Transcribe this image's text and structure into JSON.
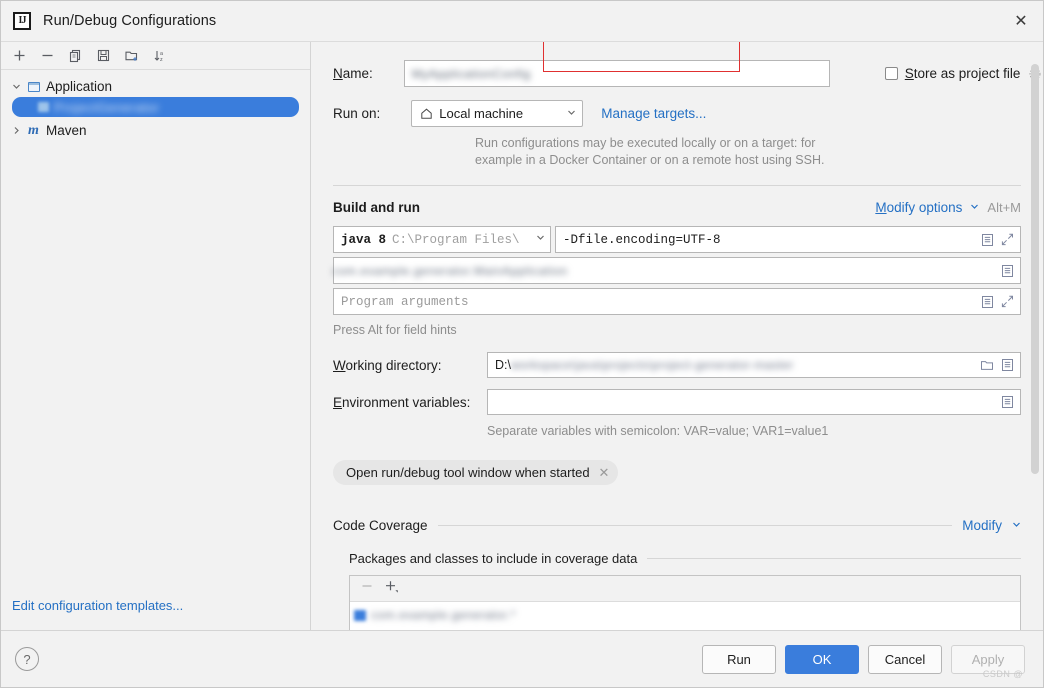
{
  "window": {
    "title": "Run/Debug Configurations",
    "logo_text": "IJ",
    "close_icon": "close-icon"
  },
  "tree_toolbar": {
    "buttons": [
      {
        "name": "add-configuration",
        "icon": "plus-icon"
      },
      {
        "name": "remove-configuration",
        "icon": "minus-icon"
      },
      {
        "name": "copy-configuration",
        "icon": "copy-icon"
      },
      {
        "name": "save-configuration",
        "icon": "save-icon"
      },
      {
        "name": "new-folder",
        "icon": "new-folder-icon"
      },
      {
        "name": "sort-configurations",
        "icon": "sort-alphabetical-icon"
      }
    ]
  },
  "tree": {
    "nodes": [
      {
        "label": "Application",
        "icon": "application-icon",
        "expanded": true,
        "arrow": "⌄"
      },
      {
        "label": "",
        "blurred": true,
        "selected": true,
        "icon": "application-icon"
      },
      {
        "label": "Maven",
        "icon": "maven-icon",
        "expanded": false,
        "arrow": "›"
      }
    ]
  },
  "left_panel": {
    "edit_templates_link": "Edit configuration templates..."
  },
  "form": {
    "name": {
      "label": "Name:",
      "label_mnemonic": "N",
      "value": "███████████████",
      "blurred": true
    },
    "store_as_project_file": {
      "label": "Store as project file",
      "label_mnemonic": "S",
      "checked": false,
      "gear_icon": "gear-icon"
    },
    "run_on": {
      "label": "Run on:",
      "selected": "Local machine",
      "icon": "home-icon",
      "chevron": "⌄",
      "manage_targets_link": "Manage targets...",
      "hint_line1": "Run configurations may be executed locally or on a target: for",
      "hint_line2": "example in a Docker Container or on a remote host using SSH."
    }
  },
  "build_and_run": {
    "title": "Build and run",
    "modify_options_link": "Modify options",
    "modify_options_mnemonic": "M",
    "modify_chevron": "⌄",
    "shortcut": "Alt+M",
    "jdk": {
      "name": "java 8",
      "path": "C:\\Program Files\\",
      "chevron": "⌄"
    },
    "vm_options": {
      "value": "-Dfile.encoding=UTF-8",
      "highlighted": true,
      "highlight_color": "#e03030",
      "icons": [
        "list-icon",
        "expand-icon"
      ]
    },
    "main_class": {
      "value": "███████████████████████",
      "blurred": true,
      "icons": [
        "list-icon"
      ]
    },
    "program_arguments": {
      "placeholder": "Program arguments",
      "value": "",
      "icons": [
        "list-icon",
        "expand-icon"
      ]
    },
    "alt_hint": "Press Alt for field hints"
  },
  "working_directory": {
    "label": "Working directory:",
    "label_mnemonic": "W",
    "value_prefix": "D:\\",
    "value_blurred": "███████████████████████████████████",
    "icons": [
      "folder-browse-icon",
      "list-icon"
    ]
  },
  "environment_variables": {
    "label": "Environment variables:",
    "label_mnemonic": "E",
    "value": "",
    "icons": [
      "list-icon"
    ],
    "hint": "Separate variables with semicolon: VAR=value; VAR1=value1"
  },
  "option_chip": {
    "label": "Open run/debug tool window when started",
    "close_icon": "close-icon"
  },
  "code_coverage": {
    "title": "Code Coverage",
    "modify_link": "Modify",
    "modify_chevron": "⌄",
    "subsection_title": "Packages and classes to include in coverage data",
    "toolbar": [
      {
        "name": "remove-package",
        "icon": "minus-icon",
        "enabled": false
      },
      {
        "name": "add-package",
        "icon": "plus-dropdown-icon",
        "enabled": true
      }
    ],
    "items": [
      {
        "label": "███████████████",
        "blurred": true
      }
    ]
  },
  "footer": {
    "help_icon": "help-icon",
    "buttons": [
      {
        "label": "Run",
        "style": "default",
        "enabled": true
      },
      {
        "label": "OK",
        "style": "primary",
        "enabled": true
      },
      {
        "label": "Cancel",
        "style": "default",
        "enabled": true
      },
      {
        "label": "Apply",
        "style": "default",
        "enabled": false
      }
    ],
    "watermark": "CSDN @"
  },
  "colors": {
    "accent_blue": "#3a7ddc",
    "link_blue": "#2470c4",
    "highlight_red": "#e03030",
    "background": "#f2f2f2"
  }
}
